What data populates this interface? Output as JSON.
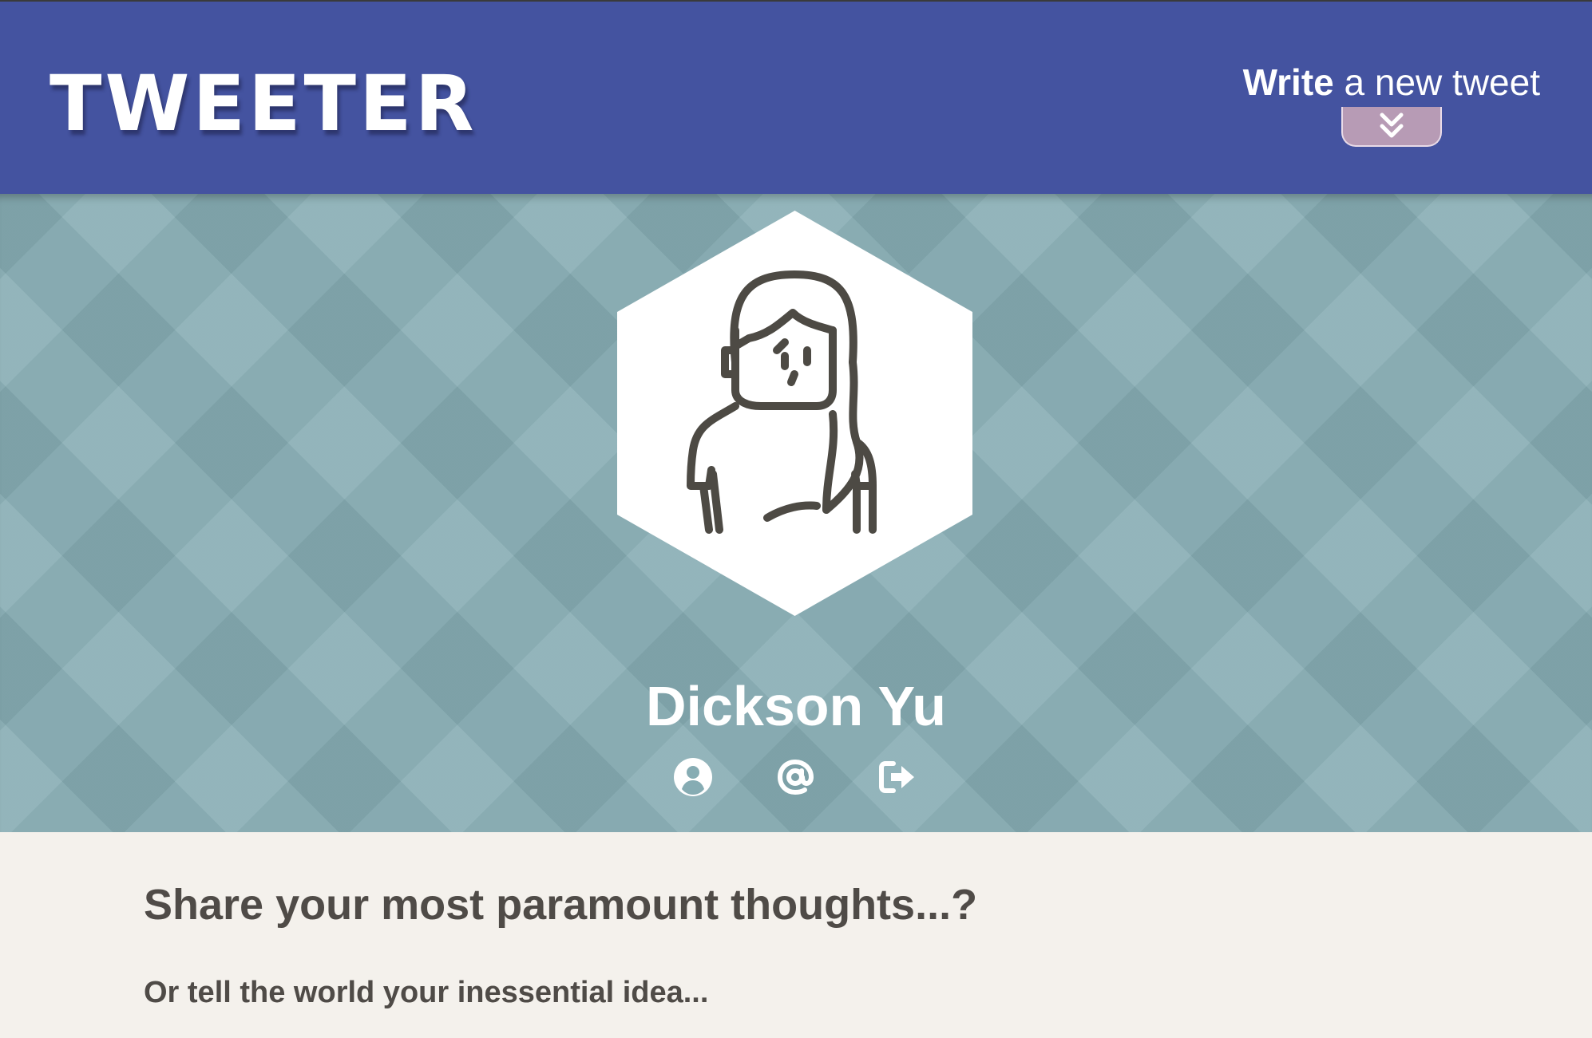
{
  "header": {
    "logo": "TWEETER",
    "compose_strong": "Write",
    "compose_rest": " a new tweet",
    "compose_toggle_icon": "double-chevron-down-icon"
  },
  "profile": {
    "name": "Dickson Yu",
    "avatar_icon": "woman-avatar-icon",
    "actions": [
      {
        "icon": "user-circle-icon"
      },
      {
        "icon": "at-sign-icon"
      },
      {
        "icon": "sign-out-icon"
      }
    ]
  },
  "composer": {
    "title": "Share your most paramount thoughts...?",
    "subtitle": "Or tell the world your inessential idea..."
  },
  "colors": {
    "header_bg": "#4453a0",
    "banner_bg": "#86acb3",
    "toggle_bg": "#b79bb5",
    "content_bg": "#f4f1ec",
    "text_dark": "#4f4b47"
  }
}
